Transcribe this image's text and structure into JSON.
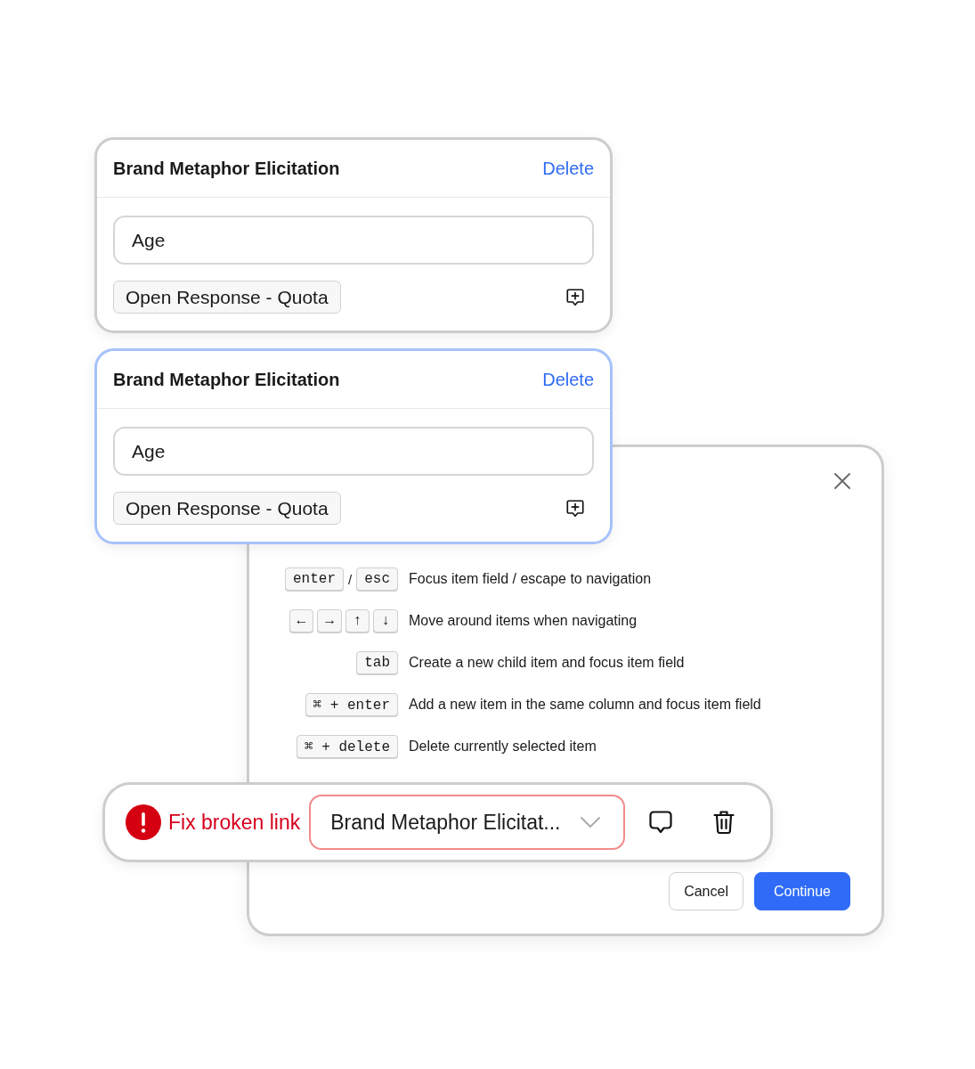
{
  "cards": [
    {
      "title": "Brand Metaphor Elicitation",
      "delete_label": "Delete",
      "field_value": "Age",
      "question_type": "Open Response - Quota",
      "selected": false
    },
    {
      "title": "Brand Metaphor Elicitation",
      "delete_label": "Delete",
      "field_value": "Age",
      "question_type": "Open Response - Quota",
      "selected": true
    }
  ],
  "shortcuts_dialog": {
    "shortcuts": [
      {
        "keys": [
          {
            "kind": "key",
            "label": "enter"
          },
          {
            "kind": "separator",
            "label": "/"
          },
          {
            "kind": "key",
            "label": "esc"
          }
        ],
        "description": "Focus item field / escape to navigation"
      },
      {
        "keys": [
          {
            "kind": "key",
            "label": "←"
          },
          {
            "kind": "key",
            "label": "→"
          },
          {
            "kind": "key",
            "label": "↑"
          },
          {
            "kind": "key",
            "label": "↓"
          }
        ],
        "description": "Move around items when navigating"
      },
      {
        "keys": [
          {
            "kind": "key",
            "label": "tab"
          }
        ],
        "description": "Create a new child item and focus item field"
      },
      {
        "keys": [
          {
            "kind": "key",
            "label": "⌘ + enter"
          }
        ],
        "description": "Add a new item in the same column and focus item field"
      },
      {
        "keys": [
          {
            "kind": "key",
            "label": "⌘ + delete"
          }
        ],
        "description": "Delete currently selected item"
      }
    ],
    "buttons": [
      {
        "label": "Cancel",
        "kind": "secondary"
      },
      {
        "label": "Continue",
        "kind": "primary"
      }
    ]
  },
  "link_bar": {
    "status": "Fix broken link",
    "link_target": "Brand Metaphor Elicitat..."
  }
}
